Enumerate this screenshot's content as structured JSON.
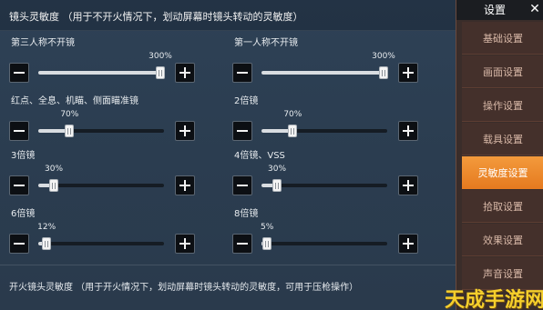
{
  "header": {
    "text": "镜头灵敏度 （用于不开火情况下，划动屏幕时镜头转动的灵敏度）"
  },
  "sliders": [
    {
      "label": "第三人称不开镜",
      "value_text": "300%",
      "value": 300,
      "min": 0,
      "max": 300
    },
    {
      "label": "第一人称不开镜",
      "value_text": "300%",
      "value": 300,
      "min": 0,
      "max": 300
    },
    {
      "label": "红点、全息、机瞄、侧面瞄准镜",
      "value_text": "70%",
      "value": 70,
      "min": 0,
      "max": 300
    },
    {
      "label": "2倍镜",
      "value_text": "70%",
      "value": 70,
      "min": 0,
      "max": 300
    },
    {
      "label": "3倍镜",
      "value_text": "30%",
      "value": 30,
      "min": 0,
      "max": 300
    },
    {
      "label": "4倍镜、VSS",
      "value_text": "30%",
      "value": 30,
      "min": 0,
      "max": 300
    },
    {
      "label": "6倍镜",
      "value_text": "12%",
      "value": 12,
      "min": 0,
      "max": 300
    },
    {
      "label": "8倍镜",
      "value_text": "5%",
      "value": 5,
      "min": 0,
      "max": 300
    }
  ],
  "footer": {
    "text": "开火镜头灵敏度 （用于开火情况下，划动屏幕时镜头转动的灵敏度，可用于压枪操作）"
  },
  "sidebar": {
    "title": "设置",
    "close_icon": "close-icon",
    "items": [
      {
        "label": "基础设置",
        "active": false
      },
      {
        "label": "画面设置",
        "active": false
      },
      {
        "label": "操作设置",
        "active": false
      },
      {
        "label": "载具设置",
        "active": false
      },
      {
        "label": "灵敏度设置",
        "active": true
      },
      {
        "label": "拾取设置",
        "active": false
      },
      {
        "label": "效果设置",
        "active": false
      },
      {
        "label": "声音设置",
        "active": false
      }
    ]
  },
  "watermark": "天成手游网",
  "colors": {
    "accent": "#f0912f",
    "panel": "#2e4156",
    "sidebar": "#3a2d2a"
  }
}
